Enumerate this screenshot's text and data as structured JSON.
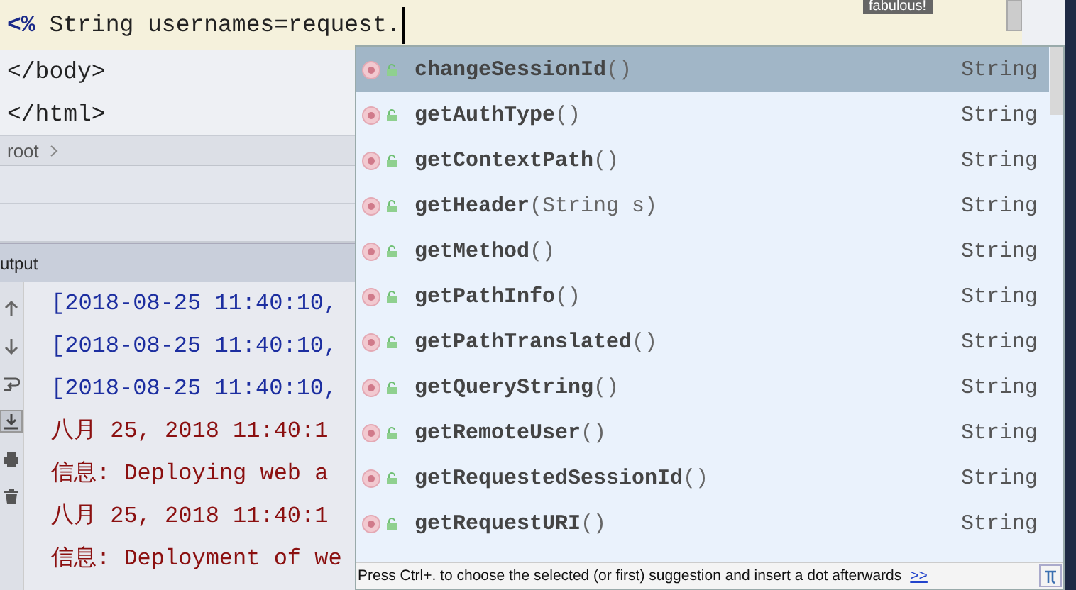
{
  "editor": {
    "lines": [
      {
        "text": "**<%** String usernames=request.",
        "caret": true
      },
      {
        "text": "</body>",
        "caret": false
      },
      {
        "text": "</html>",
        "caret": false
      }
    ],
    "tooltip": "fabulous!"
  },
  "breadcrumb": {
    "items": [
      "root"
    ]
  },
  "output_panel": {
    "title": "utput",
    "toolbar": [
      {
        "kind": "up",
        "selected": false
      },
      {
        "kind": "down",
        "selected": false
      },
      {
        "kind": "wrap",
        "selected": false
      },
      {
        "kind": "scroll-end",
        "selected": true
      },
      {
        "kind": "print",
        "selected": false
      },
      {
        "kind": "trash",
        "selected": false
      }
    ],
    "lines": [
      {
        "text": "[2018-08-25 11:40:10,",
        "kind": "log"
      },
      {
        "text": "[2018-08-25 11:40:10,",
        "kind": "log"
      },
      {
        "text": "[2018-08-25 11:40:10,",
        "kind": "log"
      },
      {
        "text": "八月 25, 2018 11:40:1",
        "kind": "err"
      },
      {
        "text": "信息: Deploying web a",
        "kind": "err"
      },
      {
        "text": "八月 25, 2018 11:40:1",
        "kind": "err"
      },
      {
        "text": "信息: Deployment of we",
        "kind": "err"
      }
    ]
  },
  "completion_popup": {
    "items": [
      {
        "signature": "**changeSessionId**()",
        "type": "String",
        "selected": true
      },
      {
        "signature": "**getAuthType**()",
        "type": "String",
        "selected": false
      },
      {
        "signature": "**getContextPath**()",
        "type": "String",
        "selected": false
      },
      {
        "signature": "**getHeader**(String s)",
        "type": "String",
        "selected": false
      },
      {
        "signature": "**getMethod**()",
        "type": "String",
        "selected": false
      },
      {
        "signature": "**getPathInfo**()",
        "type": "String",
        "selected": false
      },
      {
        "signature": "**getPathTranslated**()",
        "type": "String",
        "selected": false
      },
      {
        "signature": "**getQueryString**()",
        "type": "String",
        "selected": false
      },
      {
        "signature": "**getRemoteUser**()",
        "type": "String",
        "selected": false
      },
      {
        "signature": "**getRequestedSessionId**()",
        "type": "String",
        "selected": false
      },
      {
        "signature": "**getRequestURI**()",
        "type": "String",
        "selected": false
      }
    ],
    "hint": "Press Ctrl+. to choose the selected (or first) suggestion and insert a dot afterwards",
    "hint_link": ">>"
  }
}
